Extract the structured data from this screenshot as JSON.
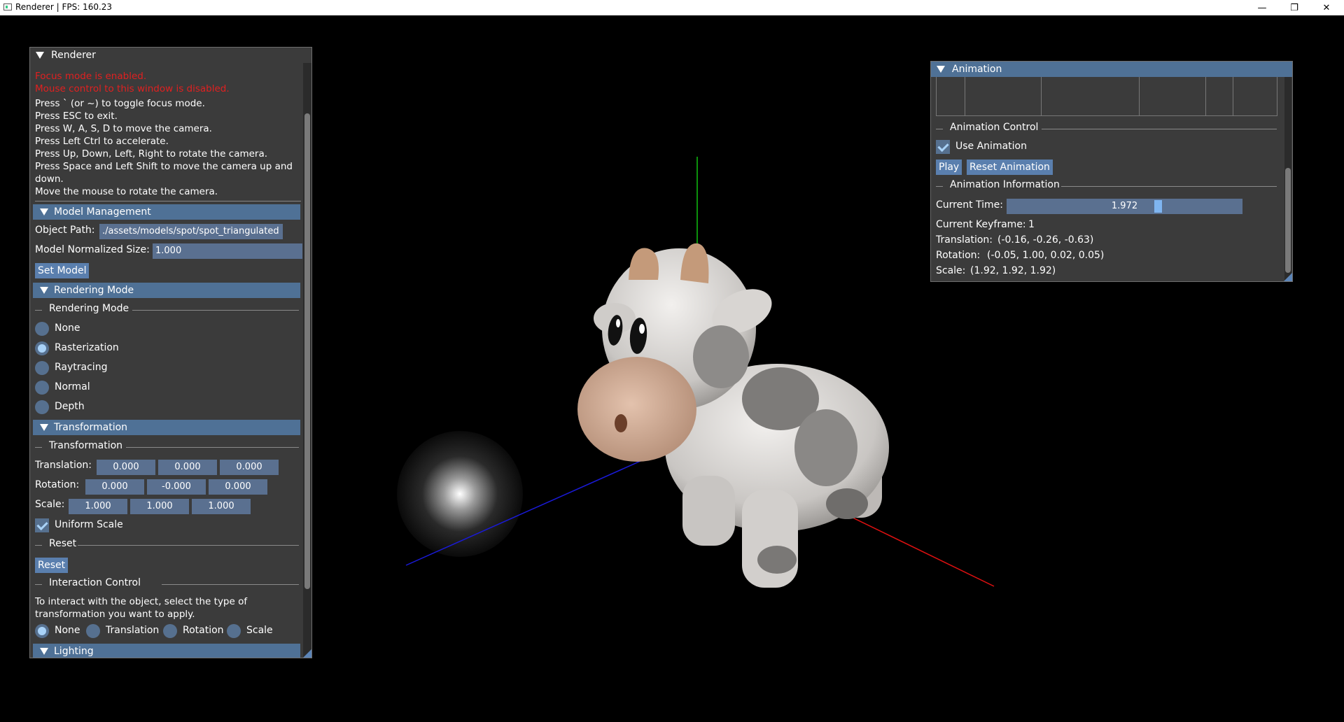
{
  "window": {
    "title": "Renderer | FPS: 160.23",
    "controls": {
      "minimize": "—",
      "maximize": "❐",
      "close": "✕"
    }
  },
  "renderer_panel": {
    "title": "Renderer",
    "focus_warning": "Focus mode is enabled.",
    "mouse_warning": "Mouse control to this window is disabled.",
    "instructions": [
      "Press ` (or ~) to toggle focus mode.",
      "Press ESC to exit.",
      "Press W, A, S, D to move the camera.",
      "Press Left Ctrl to accelerate.",
      "Press Up, Down, Left, Right to rotate the camera.",
      "Press Space and Left Shift to move the camera up and",
      "down.",
      "Move the mouse to rotate the camera."
    ],
    "model_management": {
      "header": "Model Management",
      "object_path_label": "Object Path:",
      "object_path_value": "./assets/models/spot/spot_triangulated",
      "normalized_size_label": "Model Normalized Size:",
      "normalized_size_value": "1.000",
      "set_model_button": "Set Model"
    },
    "rendering_mode": {
      "header": "Rendering Mode",
      "separator": "Rendering Mode",
      "options": [
        "None",
        "Rasterization",
        "Raytracing",
        "Normal",
        "Depth"
      ],
      "selected": "Rasterization"
    },
    "transformation": {
      "header": "Transformation",
      "separator": "Transformation",
      "translation_label": "Translation:",
      "translation": [
        "0.000",
        "0.000",
        "0.000"
      ],
      "rotation_label": "Rotation:",
      "rotation": [
        "0.000",
        "-0.000",
        "0.000"
      ],
      "scale_label": "Scale:",
      "scale": [
        "1.000",
        "1.000",
        "1.000"
      ],
      "uniform_scale_label": "Uniform Scale",
      "uniform_scale_checked": true,
      "reset_separator": "Reset",
      "reset_button": "Reset",
      "interaction_separator": "Interaction Control",
      "interaction_text_1": "To interact with the object, select the type of",
      "interaction_text_2": "transformation you want to apply.",
      "interaction_options": [
        "None",
        "Translation",
        "Rotation",
        "Scale"
      ],
      "interaction_selected": "None"
    },
    "lighting": {
      "header": "Lighting"
    }
  },
  "animation_panel": {
    "title": "Animation",
    "control_separator": "Animation Control",
    "use_animation_label": "Use Animation",
    "use_animation_checked": true,
    "play_button": "Play",
    "reset_button": "Reset Animation",
    "info_separator": "Animation Information",
    "current_time_label": "Current Time:",
    "current_time_value": "1.972",
    "current_time_fraction": 0.65,
    "keyframe_label": "Current Keyframe:",
    "keyframe_value": "1",
    "translation_label": "Translation:",
    "translation_value": "(-0.16, -0.26, -0.63)",
    "rotation_label": "Rotation:",
    "rotation_value": "(-0.05, 1.00, 0.02, 0.05)",
    "scale_label": "Scale:",
    "scale_value": "(1.92, 1.92, 1.92)"
  },
  "colors": {
    "header_blue": "#4f7196",
    "panel_bg": "#3b3b3b",
    "warning_red": "#e02020",
    "axis_x": "#e01010",
    "axis_y": "#10c010",
    "axis_z": "#1010d0"
  }
}
